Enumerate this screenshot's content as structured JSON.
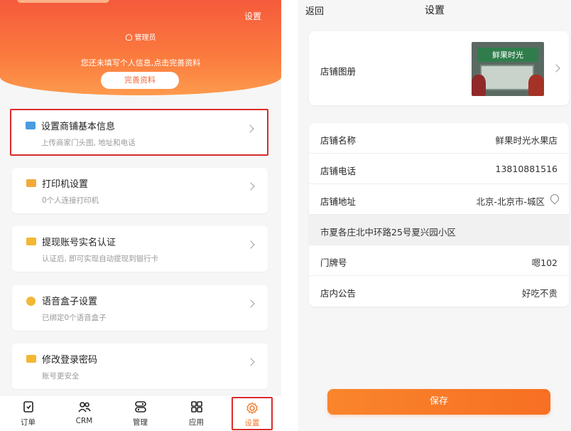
{
  "left": {
    "header": {
      "settings_label": "设置",
      "role_label": "管理员",
      "profile_prompt": "您还未填写个人信息,点击完善资料",
      "complete_button": "完善资料"
    },
    "menu": [
      {
        "title": "设置商铺基本信息",
        "subtitle": "上传商家门头图, 地址和电话",
        "icon": "shop-card-icon"
      },
      {
        "title": "打印机设置",
        "subtitle": "0个人连接打印机",
        "icon": "printer-icon"
      },
      {
        "title": "提现账号实名认证",
        "subtitle": "认证后, 即可实现自动提现到银行卡",
        "icon": "id-card-icon"
      },
      {
        "title": "语音盒子设置",
        "subtitle": "已绑定0个语音盒子",
        "icon": "speaker-icon"
      },
      {
        "title": "修改登录密码",
        "subtitle": "账号更安全",
        "icon": "lock-icon"
      }
    ],
    "tabbar": [
      {
        "label": "订单",
        "icon": "order-icon"
      },
      {
        "label": "CRM",
        "icon": "crm-icon"
      },
      {
        "label": "管理",
        "icon": "manage-icon"
      },
      {
        "label": "应用",
        "icon": "apps-icon"
      },
      {
        "label": "设置",
        "icon": "gear-icon"
      }
    ],
    "colors": {
      "accent": "#f07a2a",
      "highlight_border": "#d92c2c"
    }
  },
  "right": {
    "nav": {
      "back_label": "返回",
      "title": "设置"
    },
    "album": {
      "label": "店铺图册",
      "photo_sign": "鲜果时光"
    },
    "fields": [
      {
        "label": "店铺名称",
        "value": "鲜果时光水果店"
      },
      {
        "label": "店铺电话",
        "value": "13810881516"
      },
      {
        "label": "店铺地址",
        "value": "北京-北京市-城区"
      },
      {
        "label": "市夏各庄北中环路25号夏兴园小区",
        "value": ""
      },
      {
        "label": "门牌号",
        "value": "嗯102"
      },
      {
        "label": "店内公告",
        "value": "好吃不贵"
      }
    ],
    "save_button": "保存",
    "colors": {
      "save": "#f87a27"
    }
  }
}
